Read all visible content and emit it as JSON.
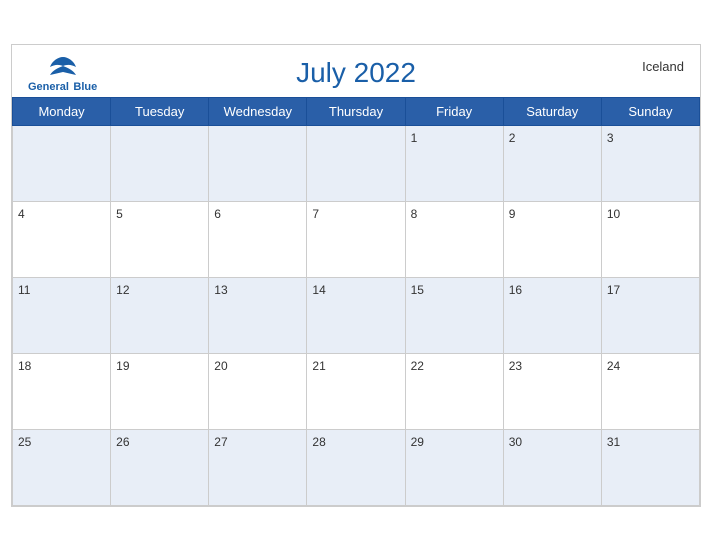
{
  "header": {
    "title": "July 2022",
    "country": "Iceland",
    "logo_general": "General",
    "logo_blue": "Blue"
  },
  "weekdays": [
    "Monday",
    "Tuesday",
    "Wednesday",
    "Thursday",
    "Friday",
    "Saturday",
    "Sunday"
  ],
  "weeks": [
    [
      null,
      null,
      null,
      null,
      1,
      2,
      3
    ],
    [
      4,
      5,
      6,
      7,
      8,
      9,
      10
    ],
    [
      11,
      12,
      13,
      14,
      15,
      16,
      17
    ],
    [
      18,
      19,
      20,
      21,
      22,
      23,
      24
    ],
    [
      25,
      26,
      27,
      28,
      29,
      30,
      31
    ]
  ]
}
